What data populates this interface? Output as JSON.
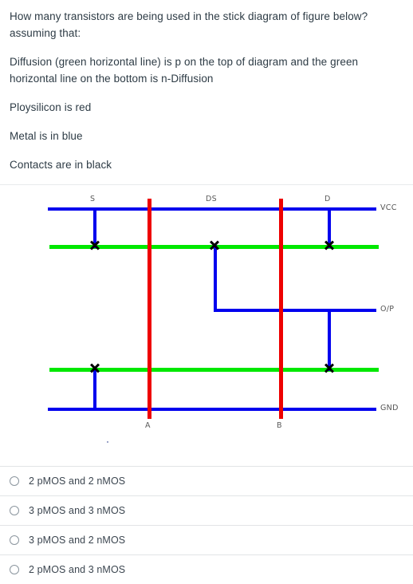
{
  "question": {
    "paragraphs": [
      "How many transistors are being used in the stick diagram of figure below?  assuming that:",
      "Diffusion (green horizontal line) is p on the top of diagram and the green horizontal line on the bottom  is n-Diffusion",
      "Ploysilicon is red",
      "Metal is in blue",
      "Contacts are in black"
    ]
  },
  "diagram": {
    "colors": {
      "metal": "#0000ee",
      "diffusion": "#00e800",
      "polysilicon": "#ee0000",
      "contact": "#000000"
    },
    "rail_labels": {
      "vcc": "VCC",
      "output": "O/P",
      "gnd": "GND"
    },
    "node_labels": {
      "source": "S",
      "drain_source": "DS",
      "drain": "D"
    },
    "gate_labels": {
      "left": "A",
      "right": "B"
    }
  },
  "answers": {
    "options": [
      {
        "label": "2 pMOS and 2 nMOS",
        "selected": false
      },
      {
        "label": "3 pMOS and 3 nMOS",
        "selected": false
      },
      {
        "label": "3 pMOS and 2 nMOS",
        "selected": false
      },
      {
        "label": "2 pMOS and 3 nMOS",
        "selected": false
      }
    ]
  }
}
